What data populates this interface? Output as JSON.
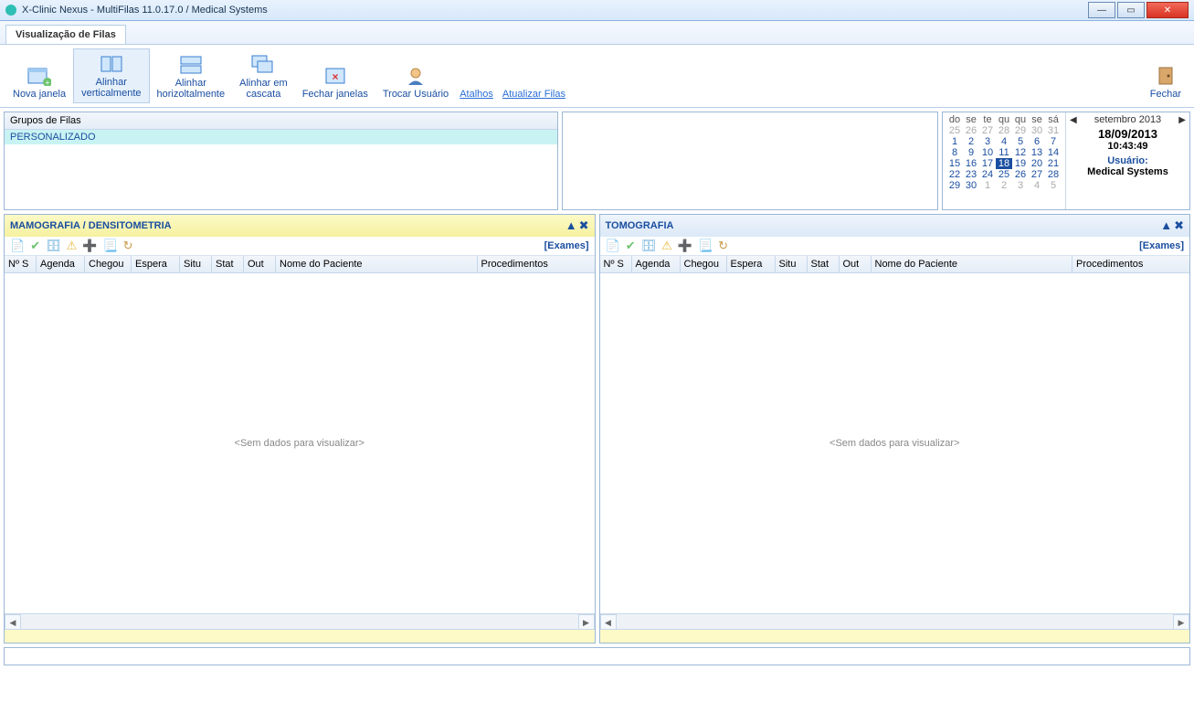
{
  "window": {
    "title": "X-Clinic Nexus - MultiFilas 11.0.17.0 / Medical Systems"
  },
  "tab": {
    "label": "Visualização de Filas"
  },
  "ribbon": {
    "nova_janela": "Nova janela",
    "alinhar_vert": "Alinhar\nverticalmente",
    "alinhar_horiz": "Alinhar\nhorizoltalmente",
    "alinhar_cascata": "Alinhar em\ncascata",
    "fechar_janelas": "Fechar janelas",
    "trocar_usuario": "Trocar Usuário",
    "fechar": "Fechar",
    "atalhos": "Atalhos",
    "atualizar": "Atualizar Filas"
  },
  "groups": {
    "header": "Grupos de Filas",
    "row1": "PERSONALIZADO"
  },
  "calendar": {
    "dow": [
      "do",
      "se",
      "te",
      "qu",
      "qu",
      "se",
      "sá"
    ],
    "weeks": [
      [
        {
          "d": "25",
          "g": 1
        },
        {
          "d": "26",
          "g": 1
        },
        {
          "d": "27",
          "g": 1
        },
        {
          "d": "28",
          "g": 1
        },
        {
          "d": "29",
          "g": 1
        },
        {
          "d": "30",
          "g": 1
        },
        {
          "d": "31",
          "g": 1
        }
      ],
      [
        {
          "d": "1"
        },
        {
          "d": "2"
        },
        {
          "d": "3"
        },
        {
          "d": "4"
        },
        {
          "d": "5"
        },
        {
          "d": "6"
        },
        {
          "d": "7"
        }
      ],
      [
        {
          "d": "8"
        },
        {
          "d": "9"
        },
        {
          "d": "10"
        },
        {
          "d": "11"
        },
        {
          "d": "12"
        },
        {
          "d": "13"
        },
        {
          "d": "14"
        }
      ],
      [
        {
          "d": "15"
        },
        {
          "d": "16"
        },
        {
          "d": "17"
        },
        {
          "d": "18",
          "t": 1
        },
        {
          "d": "19"
        },
        {
          "d": "20"
        },
        {
          "d": "21"
        }
      ],
      [
        {
          "d": "22"
        },
        {
          "d": "23"
        },
        {
          "d": "24"
        },
        {
          "d": "25"
        },
        {
          "d": "26"
        },
        {
          "d": "27"
        },
        {
          "d": "28"
        }
      ],
      [
        {
          "d": "29"
        },
        {
          "d": "30"
        },
        {
          "d": "1",
          "g": 1
        },
        {
          "d": "2",
          "g": 1
        },
        {
          "d": "3",
          "g": 1
        },
        {
          "d": "4",
          "g": 1
        },
        {
          "d": "5",
          "g": 1
        }
      ]
    ]
  },
  "info": {
    "month": "setembro 2013",
    "date": "18/09/2013",
    "time": "10:43:49",
    "user_label": "Usuário:",
    "user_name": "Medical Systems"
  },
  "panelLeft": {
    "title": "MAMOGRAFIA / DENSITOMETRIA",
    "exames": "[Exames]",
    "empty": "<Sem dados para visualizar>"
  },
  "panelRight": {
    "title": "TOMOGRAFIA",
    "exames": "[Exames]",
    "empty": "<Sem dados para visualizar>"
  },
  "columns": {
    "no": "Nº S",
    "agenda": "Agenda",
    "chegou": "Chegou",
    "espera": "Espera",
    "situ": "Situ",
    "stat": "Stat",
    "out": "Out",
    "nome": "Nome do Paciente",
    "proc": "Procedimentos"
  }
}
